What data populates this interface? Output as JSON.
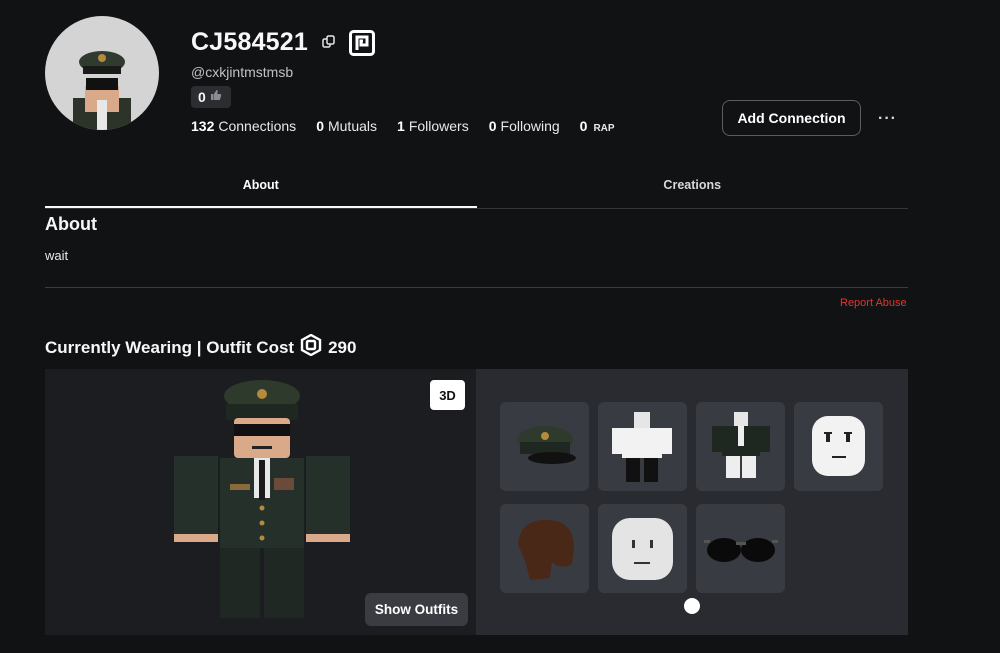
{
  "profile": {
    "display_name": "CJ584521",
    "handle": "@cxkjintmstmsb",
    "likes": "0",
    "stats": [
      {
        "value": "132",
        "label": "Connections"
      },
      {
        "value": "0",
        "label": "Mutuals"
      },
      {
        "value": "1",
        "label": "Followers"
      },
      {
        "value": "0",
        "label": "Following"
      }
    ],
    "rap": {
      "value": "0",
      "label": "RAP"
    }
  },
  "actions": {
    "add_connection": "Add Connection",
    "more": "···"
  },
  "tabs": [
    {
      "label": "About",
      "active": true
    },
    {
      "label": "Creations",
      "active": false
    }
  ],
  "about": {
    "heading": "About",
    "text": "wait",
    "report": "Report Abuse"
  },
  "wearing": {
    "heading": "Currently Wearing | Outfit Cost",
    "cost": "290",
    "toggle_3d": "3D",
    "show_outfits": "Show Outfits",
    "items": [
      {
        "icon": "military-cap-icon"
      },
      {
        "icon": "white-shirt-icon"
      },
      {
        "icon": "military-uniform-icon"
      },
      {
        "icon": "face-icon"
      },
      {
        "icon": "brown-hair-icon"
      },
      {
        "icon": "head-icon"
      },
      {
        "icon": "aviator-sunglasses-icon"
      }
    ]
  },
  "colors": {
    "background": "#111214",
    "report": "#e0362e",
    "panel_dark": "#1c1d21",
    "panel_light": "#2a2b30"
  }
}
